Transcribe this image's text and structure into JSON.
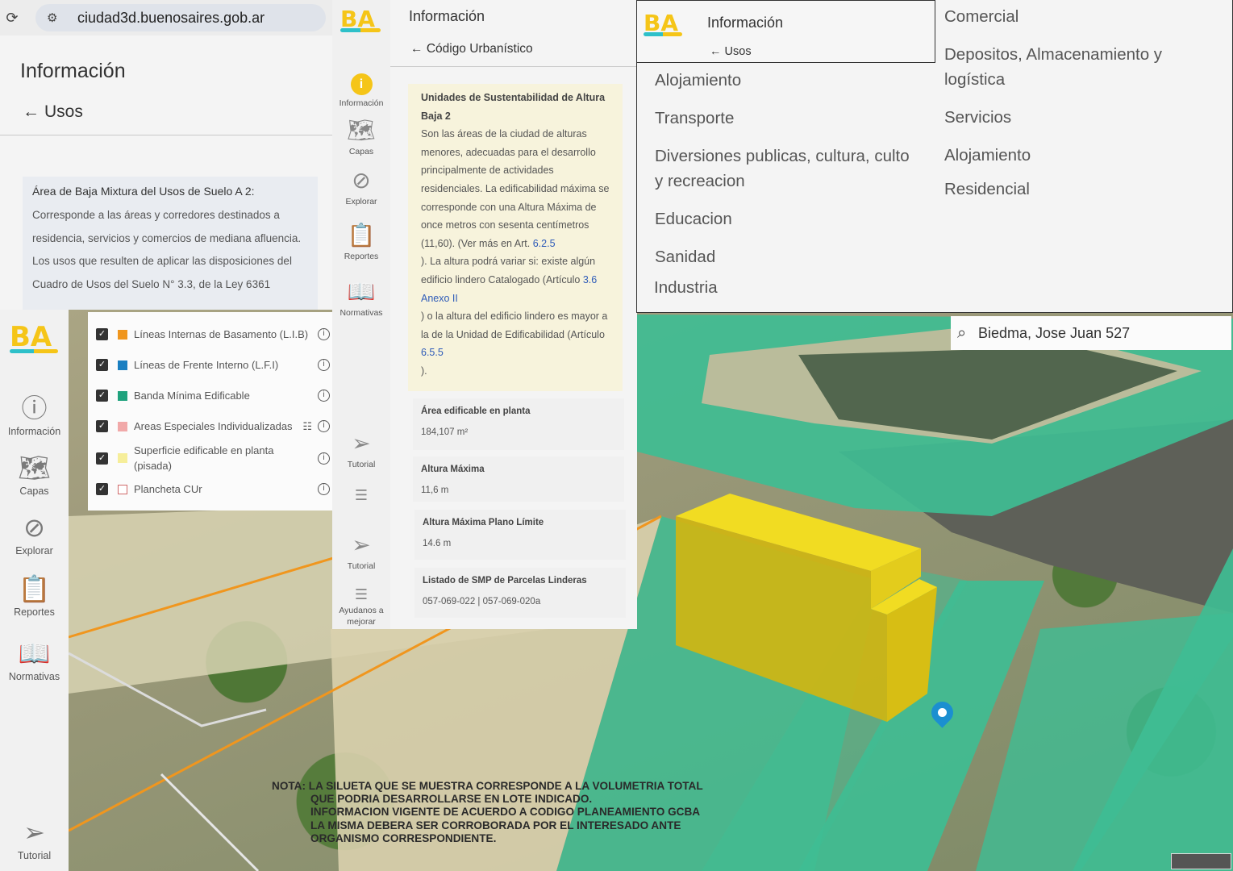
{
  "browser": {
    "url": "ciudad3d.buenosaires.gob.ar"
  },
  "info_panel": {
    "title": "Información",
    "back_label": "Usos",
    "card_title": "Área de Baja Mixtura del Usos de Suelo A 2:",
    "card_lines": [
      "Corresponde a las áreas y corredores destinados a",
      "residencia, servicios y comercios de mediana afluencia.",
      "Los usos que resulten de aplicar las disposiciones del",
      "Cuadro de Usos del Suelo N° 3.3, de la Ley 6361"
    ]
  },
  "logo_text": "BA",
  "sidebar": {
    "items": [
      {
        "label": "Información",
        "icon": "info-icon"
      },
      {
        "label": "Capas",
        "icon": "map-icon"
      },
      {
        "label": "Explorar",
        "icon": "compass-icon"
      },
      {
        "label": "Reportes",
        "icon": "clipboard-icon"
      },
      {
        "label": "Normativas",
        "icon": "book-icon"
      },
      {
        "label": "Tutorial",
        "icon": "send-icon"
      }
    ]
  },
  "layers": [
    {
      "label": "Líneas Internas de Basamento (L.I.B)",
      "color": "#f0961e",
      "checked": true
    },
    {
      "label": "Líneas de Frente Interno (L.F.I)",
      "color": "#1a7fc1",
      "checked": true
    },
    {
      "label": "Banda Mínima Edificable",
      "color": "#1fa27d",
      "checked": true
    },
    {
      "label": "Areas Especiales Individualizadas",
      "color": "#f1a9a9",
      "checked": true
    },
    {
      "label": "Superficie edificable en planta",
      "label2": "(pisada)",
      "color": "#f6ee9a",
      "checked": true
    },
    {
      "label": "Plancheta CUr",
      "color": "#ffffff",
      "border": "#d06a6a",
      "checked": true
    }
  ],
  "midnav": {
    "items": [
      "Información",
      "Capas",
      "Explorar",
      "Reportes",
      "Normativas",
      "Tutorial",
      "Tutorial"
    ],
    "help_lines": [
      "Ayudanos a",
      "mejorar"
    ]
  },
  "codigo": {
    "title": "Información",
    "back_label": "Código Urbanístico",
    "note": {
      "title_lines": [
        "Unidades de Sustentabilidad de Altura",
        "Baja 2"
      ],
      "lines": [
        "Son las áreas de la ciudad de alturas",
        "menores, adecuadas para el desarrollo",
        "principalmente de actividades",
        "residenciales. La edificabilidad máxima se",
        "corresponde con una Altura Máxima de",
        "once metros con sesenta centímetros",
        "(11,60). (Ver más en Art. ",
        "). La altura podrá variar si: existe algún",
        "edificio lindero Catalogado (Artículo ",
        "",
        ") o la altura del edificio lindero es mayor a",
        "la de la Unidad de Edificabilidad (Artículo",
        "",
        ")."
      ],
      "link1": "6.2.5",
      "link2": "3.6",
      "link3": "Anexo II",
      "link4": "6.5.5"
    },
    "fields": [
      {
        "key": "Área edificable en planta",
        "value": "184,107 m²"
      },
      {
        "key": "Altura Máxima",
        "value": "11,6 m"
      },
      {
        "key": "Altura Máxima Plano Límite",
        "value": "14.6 m"
      },
      {
        "key": "Listado de SMP de Parcelas Linderas",
        "value": "057-069-022 | 057-069-020a"
      }
    ]
  },
  "info_right": {
    "title": "Información",
    "back_label": "Usos"
  },
  "uses_left": [
    [
      "Alojamiento"
    ],
    [
      "Transporte"
    ],
    [
      "Diversiones publicas, cultura, culto",
      "y recreacion"
    ],
    [
      "Educacion"
    ],
    [
      "Sanidad"
    ],
    [
      "Industria"
    ]
  ],
  "uses_right": [
    [
      "Comercial"
    ],
    [
      "Depositos, Almacenamiento y",
      "logística"
    ],
    [
      "Servicios"
    ],
    [
      "Alojamiento"
    ],
    [
      "Residencial"
    ]
  ],
  "search": {
    "value": "Biedma, Jose Juan 527"
  },
  "disclaimer": [
    "NOTA: LA SILUETA QUE SE MUESTRA CORRESPONDE A LA VOLUMETRIA TOTAL",
    "QUE PODRIA DESARROLLARSE EN LOTE INDICADO.",
    "INFORMACION VIGENTE DE ACUERDO A CODIGO PLANEAMIENTO GCBA",
    "LA MISMA DEBERA SER CORROBORADA POR EL INTERESADO ANTE",
    "ORGANISMO CORRESPONDIENTE."
  ],
  "colors": {
    "accent": "#f5c518",
    "parcel_green": "#3fbd93",
    "volume_yellow": "#e3cc1c",
    "pin": "#1b8fd0"
  }
}
